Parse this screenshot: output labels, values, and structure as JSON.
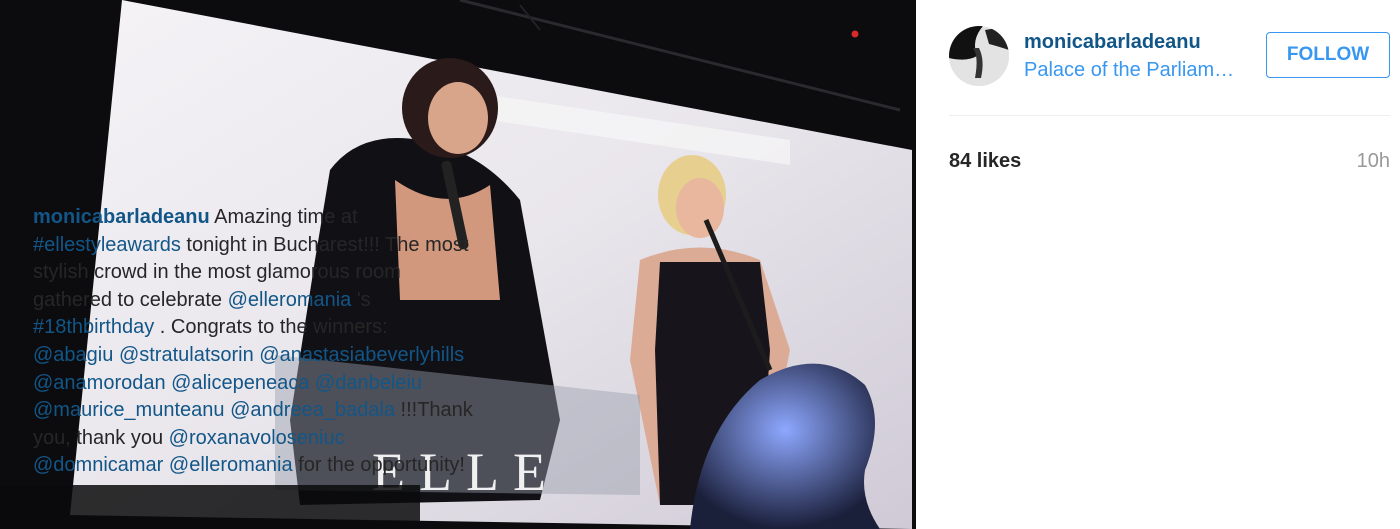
{
  "post": {
    "photo_icon": "event-photo",
    "photo_screen_text": "ELLE"
  },
  "header": {
    "username": "monicabarladeanu",
    "location": "Palace of the Parliament",
    "follow_label": "FOLLOW",
    "avatar_icon": "user-avatar"
  },
  "stats": {
    "likes": "84 likes",
    "time": "10h"
  },
  "caption": {
    "username": "monicabarladeanu",
    "t1": " Amazing time at ",
    "tag1": "#ellestyleawards",
    "t2": " tonight in Bucharest!!! The most stylish crowd in the most glamorous room gathered to celebrate ",
    "m1": "@elleromania",
    "t3": " 's ",
    "tag2": "#18thbirthday",
    "t4": " . Congrats to the winners: ",
    "m2": "@abagiu",
    "m3": "@stratulatsorin",
    "m4": "@anastasiabeverlyhills",
    "m5": "@anamorodan",
    "m6": "@alicepeneaca",
    "m7": "@danbeleiu",
    "m8": "@maurice_munteanu",
    "m9": "@andreea_badala",
    "t5": " !!!Thank you, thank you ",
    "m10": "@roxanavoloseniuc",
    "m11": "@domnicamar",
    "m12": "@elleromania",
    "t6": " for the opportunity!"
  },
  "colors": {
    "link": "#125688",
    "location_link": "#3897f0",
    "button_border": "#3897f0",
    "text": "#262626",
    "muted": "#999999"
  }
}
